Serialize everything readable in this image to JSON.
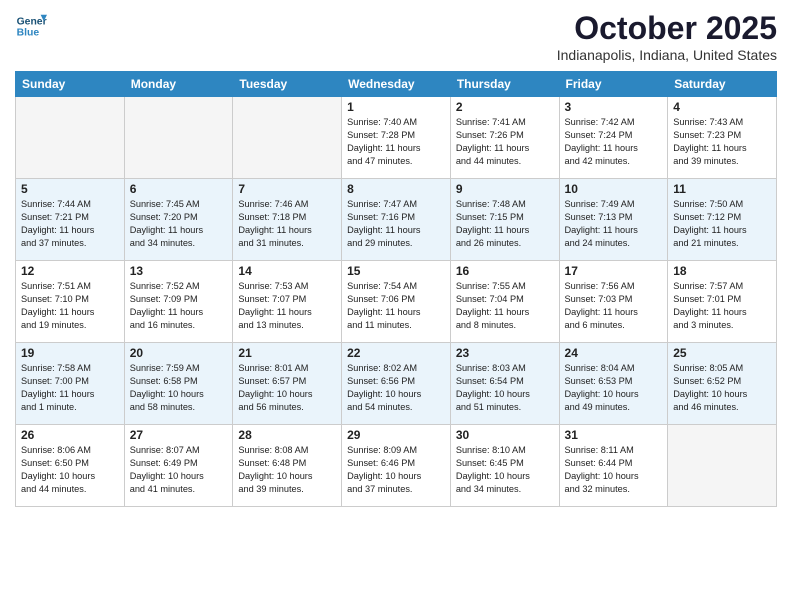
{
  "header": {
    "logo_line1": "General",
    "logo_line2": "Blue",
    "month": "October 2025",
    "location": "Indianapolis, Indiana, United States"
  },
  "weekdays": [
    "Sunday",
    "Monday",
    "Tuesday",
    "Wednesday",
    "Thursday",
    "Friday",
    "Saturday"
  ],
  "weeks": [
    [
      {
        "day": "",
        "info": ""
      },
      {
        "day": "",
        "info": ""
      },
      {
        "day": "",
        "info": ""
      },
      {
        "day": "1",
        "info": "Sunrise: 7:40 AM\nSunset: 7:28 PM\nDaylight: 11 hours\nand 47 minutes."
      },
      {
        "day": "2",
        "info": "Sunrise: 7:41 AM\nSunset: 7:26 PM\nDaylight: 11 hours\nand 44 minutes."
      },
      {
        "day": "3",
        "info": "Sunrise: 7:42 AM\nSunset: 7:24 PM\nDaylight: 11 hours\nand 42 minutes."
      },
      {
        "day": "4",
        "info": "Sunrise: 7:43 AM\nSunset: 7:23 PM\nDaylight: 11 hours\nand 39 minutes."
      }
    ],
    [
      {
        "day": "5",
        "info": "Sunrise: 7:44 AM\nSunset: 7:21 PM\nDaylight: 11 hours\nand 37 minutes."
      },
      {
        "day": "6",
        "info": "Sunrise: 7:45 AM\nSunset: 7:20 PM\nDaylight: 11 hours\nand 34 minutes."
      },
      {
        "day": "7",
        "info": "Sunrise: 7:46 AM\nSunset: 7:18 PM\nDaylight: 11 hours\nand 31 minutes."
      },
      {
        "day": "8",
        "info": "Sunrise: 7:47 AM\nSunset: 7:16 PM\nDaylight: 11 hours\nand 29 minutes."
      },
      {
        "day": "9",
        "info": "Sunrise: 7:48 AM\nSunset: 7:15 PM\nDaylight: 11 hours\nand 26 minutes."
      },
      {
        "day": "10",
        "info": "Sunrise: 7:49 AM\nSunset: 7:13 PM\nDaylight: 11 hours\nand 24 minutes."
      },
      {
        "day": "11",
        "info": "Sunrise: 7:50 AM\nSunset: 7:12 PM\nDaylight: 11 hours\nand 21 minutes."
      }
    ],
    [
      {
        "day": "12",
        "info": "Sunrise: 7:51 AM\nSunset: 7:10 PM\nDaylight: 11 hours\nand 19 minutes."
      },
      {
        "day": "13",
        "info": "Sunrise: 7:52 AM\nSunset: 7:09 PM\nDaylight: 11 hours\nand 16 minutes."
      },
      {
        "day": "14",
        "info": "Sunrise: 7:53 AM\nSunset: 7:07 PM\nDaylight: 11 hours\nand 13 minutes."
      },
      {
        "day": "15",
        "info": "Sunrise: 7:54 AM\nSunset: 7:06 PM\nDaylight: 11 hours\nand 11 minutes."
      },
      {
        "day": "16",
        "info": "Sunrise: 7:55 AM\nSunset: 7:04 PM\nDaylight: 11 hours\nand 8 minutes."
      },
      {
        "day": "17",
        "info": "Sunrise: 7:56 AM\nSunset: 7:03 PM\nDaylight: 11 hours\nand 6 minutes."
      },
      {
        "day": "18",
        "info": "Sunrise: 7:57 AM\nSunset: 7:01 PM\nDaylight: 11 hours\nand 3 minutes."
      }
    ],
    [
      {
        "day": "19",
        "info": "Sunrise: 7:58 AM\nSunset: 7:00 PM\nDaylight: 11 hours\nand 1 minute."
      },
      {
        "day": "20",
        "info": "Sunrise: 7:59 AM\nSunset: 6:58 PM\nDaylight: 10 hours\nand 58 minutes."
      },
      {
        "day": "21",
        "info": "Sunrise: 8:01 AM\nSunset: 6:57 PM\nDaylight: 10 hours\nand 56 minutes."
      },
      {
        "day": "22",
        "info": "Sunrise: 8:02 AM\nSunset: 6:56 PM\nDaylight: 10 hours\nand 54 minutes."
      },
      {
        "day": "23",
        "info": "Sunrise: 8:03 AM\nSunset: 6:54 PM\nDaylight: 10 hours\nand 51 minutes."
      },
      {
        "day": "24",
        "info": "Sunrise: 8:04 AM\nSunset: 6:53 PM\nDaylight: 10 hours\nand 49 minutes."
      },
      {
        "day": "25",
        "info": "Sunrise: 8:05 AM\nSunset: 6:52 PM\nDaylight: 10 hours\nand 46 minutes."
      }
    ],
    [
      {
        "day": "26",
        "info": "Sunrise: 8:06 AM\nSunset: 6:50 PM\nDaylight: 10 hours\nand 44 minutes."
      },
      {
        "day": "27",
        "info": "Sunrise: 8:07 AM\nSunset: 6:49 PM\nDaylight: 10 hours\nand 41 minutes."
      },
      {
        "day": "28",
        "info": "Sunrise: 8:08 AM\nSunset: 6:48 PM\nDaylight: 10 hours\nand 39 minutes."
      },
      {
        "day": "29",
        "info": "Sunrise: 8:09 AM\nSunset: 6:46 PM\nDaylight: 10 hours\nand 37 minutes."
      },
      {
        "day": "30",
        "info": "Sunrise: 8:10 AM\nSunset: 6:45 PM\nDaylight: 10 hours\nand 34 minutes."
      },
      {
        "day": "31",
        "info": "Sunrise: 8:11 AM\nSunset: 6:44 PM\nDaylight: 10 hours\nand 32 minutes."
      },
      {
        "day": "",
        "info": ""
      }
    ]
  ]
}
